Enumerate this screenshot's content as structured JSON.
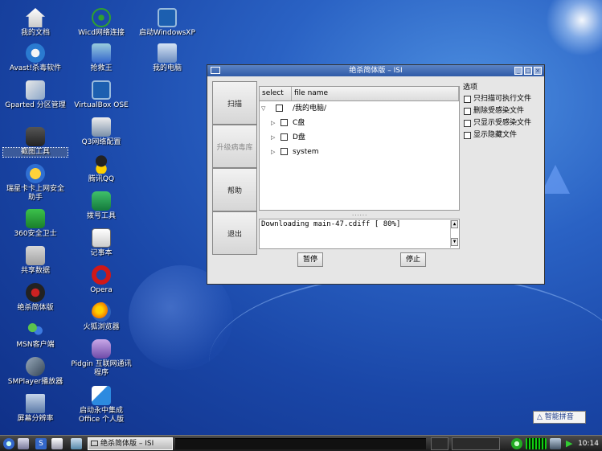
{
  "desktop": {
    "col1": [
      {
        "label": "我的文档",
        "icon": "home-icon"
      },
      {
        "label": "Avast!杀毒软件",
        "icon": "avast-icon"
      },
      {
        "label": "Gparted 分区管理",
        "icon": "gparted-icon"
      },
      {
        "label": "截图工具",
        "icon": "camera-icon"
      },
      {
        "label": "瑞星卡卡上网安全助手",
        "icon": "ruixing-icon"
      },
      {
        "label": "360安全卫士",
        "icon": "shield-360-icon"
      },
      {
        "label": "共享数据",
        "icon": "folder-icon"
      },
      {
        "label": "绝杀简体版",
        "icon": "antivirus-icon"
      },
      {
        "label": "MSN客户端",
        "icon": "msn-icon"
      },
      {
        "label": "SMPlayer播放器",
        "icon": "smplayer-icon"
      },
      {
        "label": "屏幕分辨率",
        "icon": "monitor-icon"
      }
    ],
    "col2": [
      {
        "label": "Wicd网络连接",
        "icon": "wifi-icon"
      },
      {
        "label": "抢救王",
        "icon": "rescue-icon"
      },
      {
        "label": "VirtualBox OSE",
        "icon": "virtualbox-icon"
      },
      {
        "label": "Q3网络配置",
        "icon": "network-icon"
      },
      {
        "label": "腾讯QQ",
        "icon": "qq-icon"
      },
      {
        "label": "拨号工具",
        "icon": "phone-icon"
      },
      {
        "label": "记事本",
        "icon": "notepad-icon"
      },
      {
        "label": "Opera",
        "icon": "opera-icon"
      },
      {
        "label": "火狐浏览器",
        "icon": "firefox-icon"
      },
      {
        "label": "Pidgin 互联网通讯程序",
        "icon": "pidgin-icon"
      },
      {
        "label": "启动永中集成Office 个人版",
        "icon": "office-icon"
      }
    ],
    "col3": [
      {
        "label": "启动WindowsXP",
        "icon": "winxp-icon"
      },
      {
        "label": "我的电脑",
        "icon": "computer-icon"
      }
    ]
  },
  "window": {
    "title": "绝杀简体版 – ISI",
    "left_buttons": [
      "扫描",
      "升级病毒库",
      "帮助",
      "退出"
    ],
    "tree": {
      "col_select": "select",
      "col_name": "file name",
      "rows": [
        {
          "label": "/我的电脑/",
          "expanded": true
        },
        {
          "label": "C盘"
        },
        {
          "label": "D盘"
        },
        {
          "label": "system"
        }
      ]
    },
    "splitter": "......",
    "log_text": "Downloading main-47.cdiff [ 80%]",
    "pause_label": "暂停",
    "stop_label": "停止",
    "options": {
      "title": "选项",
      "items": [
        "只扫描可执行文件",
        "删除受感染文件",
        "只显示受感染文件",
        "显示隐藏文件"
      ]
    }
  },
  "ime": {
    "label": "智能拼音"
  },
  "taskbar": {
    "task_label": "绝杀简体版 – ISI",
    "clock": "10:14"
  },
  "colors": {
    "accent": "#2f5aa7",
    "desktop": "#1a47a8",
    "taskbar": "#1d1d1d"
  }
}
